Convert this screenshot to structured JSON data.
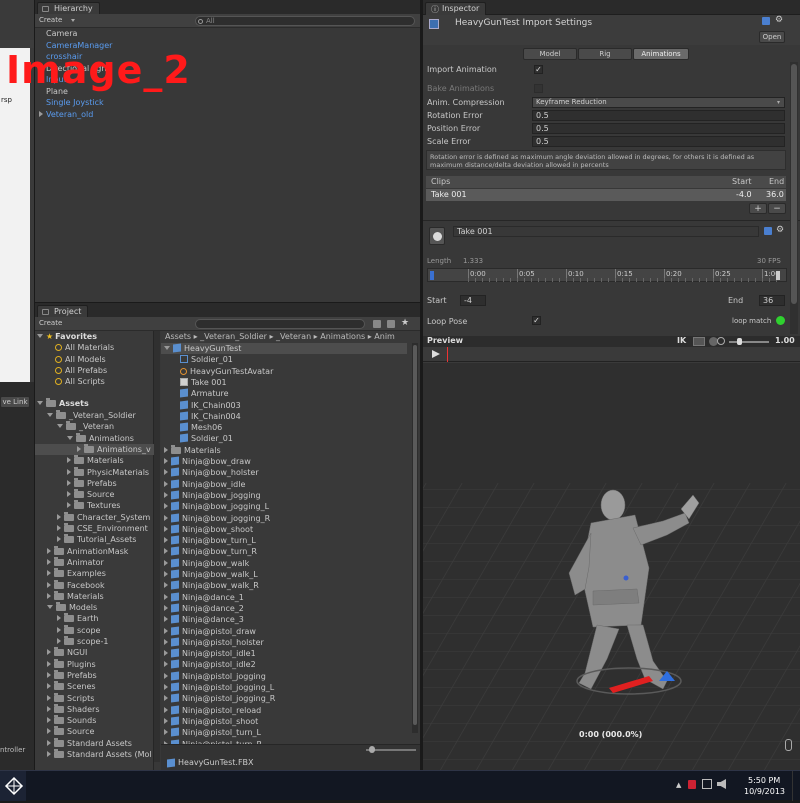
{
  "watermark": "Image_2",
  "scene_left": {
    "persp": "rsp",
    "live_link": "ve Link",
    "controller": "ntroller"
  },
  "hierarchy": {
    "tab": "Hierarchy",
    "create": "Create",
    "search": "All",
    "items": [
      {
        "label": "Camera",
        "blue": false,
        "arrow": false
      },
      {
        "label": "CameraManager",
        "blue": true,
        "arrow": false
      },
      {
        "label": "crosshair",
        "blue": true,
        "arrow": false
      },
      {
        "label": "Directional light",
        "blue": false,
        "arrow": false
      },
      {
        "label": "Input",
        "blue": true,
        "arrow": false
      },
      {
        "label": "Plane",
        "blue": false,
        "arrow": false
      },
      {
        "label": "Single Joystick",
        "blue": true,
        "arrow": false
      },
      {
        "label": "Veteran_old",
        "blue": true,
        "arrow": true
      }
    ]
  },
  "project": {
    "tab": "Project",
    "create": "Create",
    "breadcrumb": "Assets ▸ _Veteran_Soldier ▸ _Veteran ▸ Animations ▸ Anim",
    "favorites_label": "Favorites",
    "favorites": [
      "All Materials",
      "All Models",
      "All Prefabs",
      "All Scripts"
    ],
    "assets_label": "Assets",
    "tree": [
      {
        "label": "_Veteran_Soldier",
        "indent": 1,
        "open": true
      },
      {
        "label": "_Veteran",
        "indent": 2,
        "open": true
      },
      {
        "label": "Animations",
        "indent": 3,
        "open": true
      },
      {
        "label": "Animations_v",
        "indent": 4,
        "open": false,
        "selected": true
      },
      {
        "label": "Materials",
        "indent": 3,
        "open": false
      },
      {
        "label": "PhysicMaterials",
        "indent": 3,
        "open": false
      },
      {
        "label": "Prefabs",
        "indent": 3,
        "open": false
      },
      {
        "label": "Source",
        "indent": 3,
        "open": false
      },
      {
        "label": "Textures",
        "indent": 3,
        "open": false
      },
      {
        "label": "Character_System",
        "indent": 2,
        "open": false
      },
      {
        "label": "CSE_Environment",
        "indent": 2,
        "open": false
      },
      {
        "label": "Tutorial_Assets",
        "indent": 2,
        "open": false
      },
      {
        "label": "AnimationMask",
        "indent": 1,
        "open": false
      },
      {
        "label": "Animator",
        "indent": 1,
        "open": false
      },
      {
        "label": "Examples",
        "indent": 1,
        "open": false
      },
      {
        "label": "Facebook",
        "indent": 1,
        "open": false
      },
      {
        "label": "Materials",
        "indent": 1,
        "open": false
      },
      {
        "label": "Models",
        "indent": 1,
        "open": true
      },
      {
        "label": "Earth",
        "indent": 2,
        "open": false
      },
      {
        "label": "scope",
        "indent": 2,
        "open": false
      },
      {
        "label": "scope-1",
        "indent": 2,
        "open": false
      },
      {
        "label": "NGUI",
        "indent": 1,
        "open": false
      },
      {
        "label": "Plugins",
        "indent": 1,
        "open": false
      },
      {
        "label": "Prefabs",
        "indent": 1,
        "open": false
      },
      {
        "label": "Scenes",
        "indent": 1,
        "open": false
      },
      {
        "label": "Scripts",
        "indent": 1,
        "open": false
      },
      {
        "label": "Shaders",
        "indent": 1,
        "open": false
      },
      {
        "label": "Sounds",
        "indent": 1,
        "open": false
      },
      {
        "label": "Source",
        "indent": 1,
        "open": false
      },
      {
        "label": "Standard Assets",
        "indent": 1,
        "open": false
      },
      {
        "label": "Standard Assets (Mol",
        "indent": 1,
        "open": false
      }
    ],
    "files": [
      {
        "label": "HeavyGunTest",
        "indent": 0,
        "kind": "cube",
        "open": true,
        "selected": true
      },
      {
        "label": "Soldier_01",
        "indent": 1,
        "kind": "mesh"
      },
      {
        "label": "HeavyGunTestAvatar",
        "indent": 1,
        "kind": "avatar"
      },
      {
        "label": "Take 001",
        "indent": 1,
        "kind": "anim"
      },
      {
        "label": "Armature",
        "indent": 1,
        "kind": "cube"
      },
      {
        "label": "IK_Chain003",
        "indent": 1,
        "kind": "cube"
      },
      {
        "label": "IK_Chain004",
        "indent": 1,
        "kind": "cube"
      },
      {
        "label": "Mesh06",
        "indent": 1,
        "kind": "cube"
      },
      {
        "label": "Soldier_01",
        "indent": 1,
        "kind": "cube"
      },
      {
        "label": "Materials",
        "indent": 0,
        "kind": "folder"
      },
      {
        "label": "Ninja@bow_draw",
        "indent": 0,
        "kind": "cube"
      },
      {
        "label": "Ninja@bow_holster",
        "indent": 0,
        "kind": "cube"
      },
      {
        "label": "Ninja@bow_idle",
        "indent": 0,
        "kind": "cube"
      },
      {
        "label": "Ninja@bow_jogging",
        "indent": 0,
        "kind": "cube"
      },
      {
        "label": "Ninja@bow_jogging_L",
        "indent": 0,
        "kind": "cube"
      },
      {
        "label": "Ninja@bow_jogging_R",
        "indent": 0,
        "kind": "cube"
      },
      {
        "label": "Ninja@bow_shoot",
        "indent": 0,
        "kind": "cube"
      },
      {
        "label": "Ninja@bow_turn_L",
        "indent": 0,
        "kind": "cube"
      },
      {
        "label": "Ninja@bow_turn_R",
        "indent": 0,
        "kind": "cube"
      },
      {
        "label": "Ninja@bow_walk",
        "indent": 0,
        "kind": "cube"
      },
      {
        "label": "Ninja@bow_walk_L",
        "indent": 0,
        "kind": "cube"
      },
      {
        "label": "Ninja@bow_walk_R",
        "indent": 0,
        "kind": "cube"
      },
      {
        "label": "Ninja@dance_1",
        "indent": 0,
        "kind": "cube"
      },
      {
        "label": "Ninja@dance_2",
        "indent": 0,
        "kind": "cube"
      },
      {
        "label": "Ninja@dance_3",
        "indent": 0,
        "kind": "cube"
      },
      {
        "label": "Ninja@pistol_draw",
        "indent": 0,
        "kind": "cube"
      },
      {
        "label": "Ninja@pistol_holster",
        "indent": 0,
        "kind": "cube"
      },
      {
        "label": "Ninja@pistol_idle1",
        "indent": 0,
        "kind": "cube"
      },
      {
        "label": "Ninja@pistol_idle2",
        "indent": 0,
        "kind": "cube"
      },
      {
        "label": "Ninja@pistol_jogging",
        "indent": 0,
        "kind": "cube"
      },
      {
        "label": "Ninja@pistol_jogging_L",
        "indent": 0,
        "kind": "cube"
      },
      {
        "label": "Ninja@pistol_jogging_R",
        "indent": 0,
        "kind": "cube"
      },
      {
        "label": "Ninja@pistol_reload",
        "indent": 0,
        "kind": "cube"
      },
      {
        "label": "Ninja@pistol_shoot",
        "indent": 0,
        "kind": "cube"
      },
      {
        "label": "Ninja@pistol_turn_L",
        "indent": 0,
        "kind": "cube"
      },
      {
        "label": "Ninja@pistol_turn_R",
        "indent": 0,
        "kind": "cube"
      }
    ],
    "footer_file": "HeavyGunTest.FBX"
  },
  "inspector": {
    "tab": "Inspector",
    "title": "HeavyGunTest Import Settings",
    "open_btn": "Open",
    "tabs": [
      "Model",
      "Rig",
      "Animations"
    ],
    "active_tab": 2,
    "import_animation": "Import Animation",
    "bake_animations": "Bake Animations",
    "anim_compression": "Anim. Compression",
    "compression_value": "Keyframe Reduction",
    "rotation_error": "Rotation Error",
    "rotation_value": "0.5",
    "position_error": "Position Error",
    "position_value": "0.5",
    "scale_error": "Scale Error",
    "scale_value": "0.5",
    "help": "Rotation error is defined as maximum angle deviation allowed in degrees, for others it is defined as maximum distance/delta deviation allowed in percents",
    "clips_header": "Clips",
    "start_header": "Start",
    "end_header": "End",
    "clip_name": "Take 001",
    "clip_start": "-4.0",
    "clip_end": "36.0",
    "plus": "+",
    "minus": "−",
    "take_name": "Take 001",
    "length_label": "Length",
    "length_value": "1.333",
    "fps": "30 FPS",
    "timeline_ticks": [
      "0:00",
      "0:05",
      "0:10",
      "0:15",
      "0:20",
      "0:25",
      "1:00"
    ],
    "start_label": "Start",
    "start_value": "-4",
    "end_label": "End",
    "end_value": "36",
    "loop_pose": "Loop Pose",
    "loop_match": "loop match",
    "loop_match_color": "#2fd12f"
  },
  "preview": {
    "title": "Preview",
    "ik": "IK",
    "speed": "1.00",
    "timestamp": "0:00 (000.0%)"
  },
  "taskbar": {
    "time": "5:50 PM",
    "date": "10/9/2013"
  }
}
